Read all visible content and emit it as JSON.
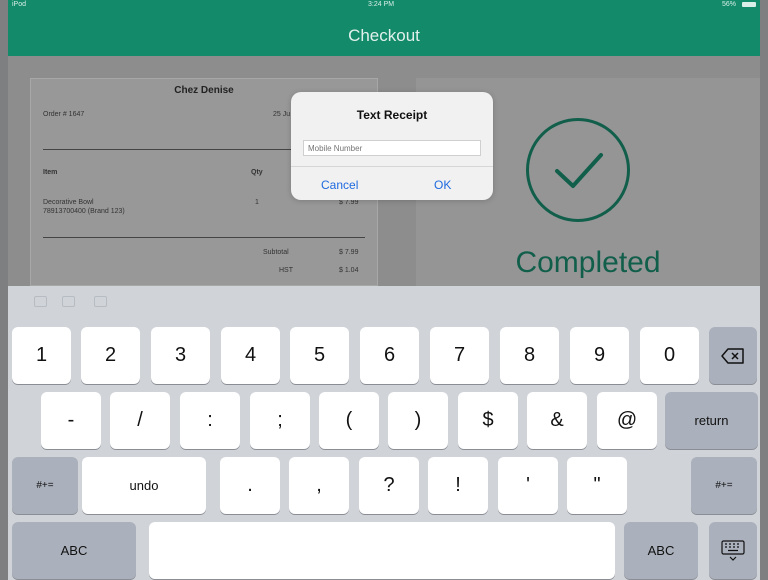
{
  "status_bar": {
    "carrier": "iPod",
    "time": "3:24 PM",
    "battery": "56%"
  },
  "nav": {
    "title": "Checkout"
  },
  "receipt": {
    "store_name": "Chez Denise",
    "order_number": "Order # 1647",
    "date_fragment": "25 Ju",
    "columns": {
      "item": "Item",
      "qty": "Qty"
    },
    "line_item": {
      "name": "Decorative Bowl",
      "sku": "78913700400 (Brand 123)",
      "qty": "1",
      "price": "$ 7.99"
    },
    "totals": [
      {
        "label": "Subtotal",
        "value": "$ 7.99"
      },
      {
        "label": "HST",
        "value": "$ 1.04"
      }
    ]
  },
  "status": {
    "completed_label": "Completed"
  },
  "alert": {
    "title": "Text Receipt",
    "input_placeholder": "Mobile Number",
    "cancel_label": "Cancel",
    "ok_label": "OK"
  },
  "keyboard": {
    "row1": [
      "1",
      "2",
      "3",
      "4",
      "5",
      "6",
      "7",
      "8",
      "9",
      "0"
    ],
    "row2": [
      "-",
      "/",
      ":",
      ";",
      "(",
      ")",
      "$",
      "&",
      "@"
    ],
    "return_label": "return",
    "row3_symbols": [
      ".",
      ",",
      "?",
      "!",
      "'",
      "\""
    ],
    "more_symbols_label": "#+=",
    "undo_label": "undo",
    "abc_label": "ABC",
    "icons": [
      "backspace-icon",
      "keyboard-dismiss-icon",
      "undo-icon",
      "redo-icon",
      "paste-icon",
      "check-icon"
    ]
  },
  "colors": {
    "brand_green": "#138a6a",
    "completed_green": "#115f4b",
    "link_blue": "#1f6ae0"
  }
}
